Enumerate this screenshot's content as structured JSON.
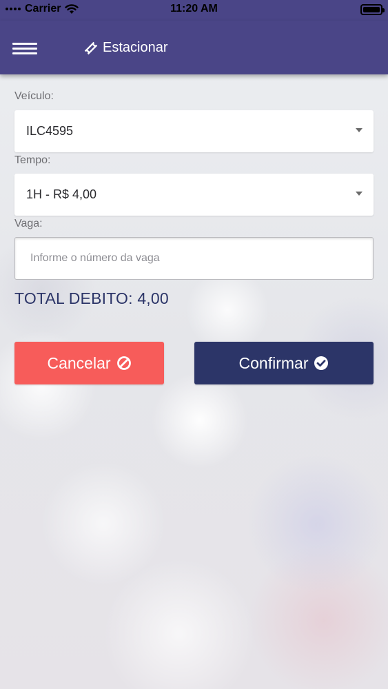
{
  "status_bar": {
    "carrier": "Carrier",
    "time": "11:20 AM",
    "icons": [
      "signal-dots-icon",
      "wifi-icon",
      "battery-icon"
    ]
  },
  "nav": {
    "title": "Estacionar",
    "menu_icon": "hamburger-menu-icon",
    "title_icon": "ticket-icon",
    "background": "#4a4587"
  },
  "form": {
    "vehicle": {
      "label": "Veículo:",
      "value": "ILC4595"
    },
    "time": {
      "label": "Tempo:",
      "value": "1H - R$ 4,00"
    },
    "spot": {
      "label": "Vaga:",
      "placeholder": "Informe o número da vaga",
      "value": ""
    }
  },
  "total": "TOTAL DEBITO: 4,00",
  "buttons": {
    "cancel": {
      "label": "Cancelar",
      "icon": "ban-icon",
      "color": "#f75c5a"
    },
    "confirm": {
      "label": "Confirmar",
      "icon": "check-circle-icon",
      "color": "#2c3568"
    }
  }
}
